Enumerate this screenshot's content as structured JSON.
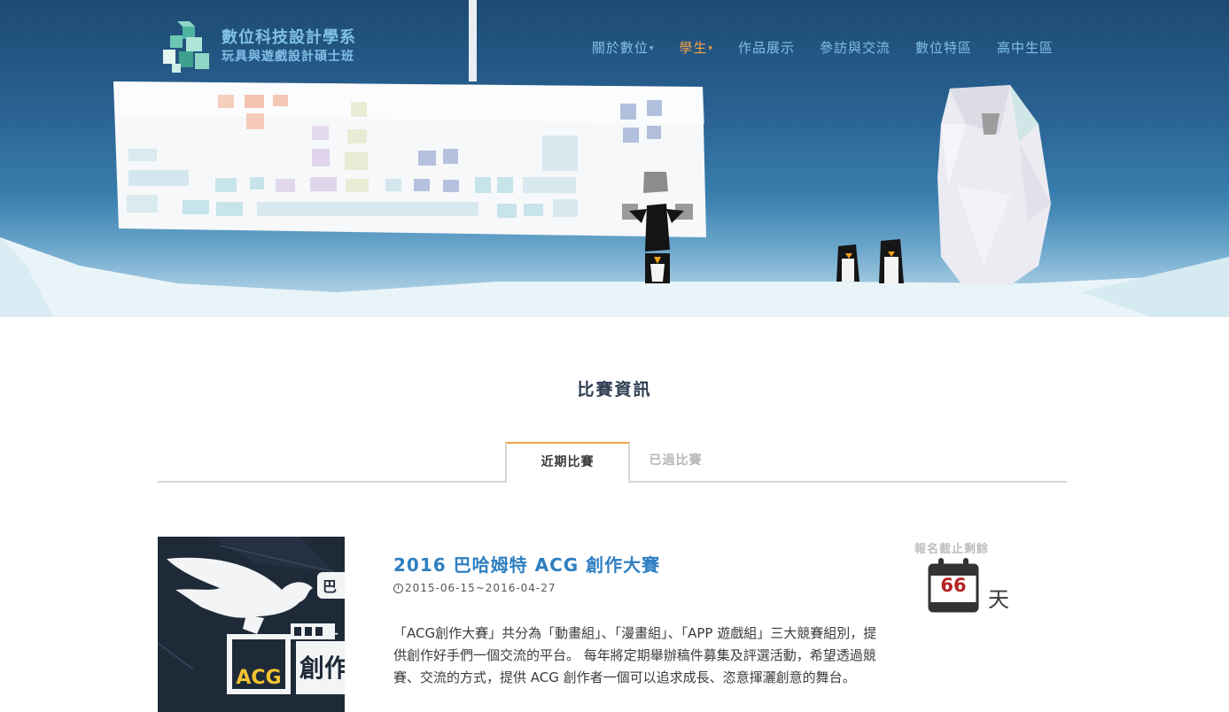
{
  "header": {
    "logo_line1": "數位科技設計學系",
    "logo_line2": "玩具與遊戲設計碩士班",
    "nav": [
      {
        "label": "關於數位",
        "dropdown": true,
        "active": false
      },
      {
        "label": "學生",
        "dropdown": true,
        "active": true
      },
      {
        "label": "作品展示",
        "dropdown": false,
        "active": false
      },
      {
        "label": "參訪與交流",
        "dropdown": false,
        "active": false
      },
      {
        "label": "數位特區",
        "dropdown": false,
        "active": false
      },
      {
        "label": "高中生區",
        "dropdown": false,
        "active": false
      }
    ],
    "caret": "▾"
  },
  "section": {
    "title": "比賽資訊",
    "tabs": [
      {
        "label": "近期比賽",
        "active": true
      },
      {
        "label": "已過比賽",
        "active": false
      }
    ]
  },
  "competition": {
    "title": "2016 巴哈姆特 ACG 創作大賽",
    "date": "2015-06-15~2016-04-27",
    "description": "「ACG創作大賽」共分為「動畫組」、「漫畫組」、「APP 遊戲組」三大競賽組別，提供創作好手們一個交流的平台。 每年將定期舉辦稿件募集及評選活動，希望透過競賽、交流的方式，提供 ACG 創作者一個可以追求成長、恣意揮灑創意的舞台。",
    "countdown_label": "報名截止剩餘",
    "days_remaining": "66",
    "days_unit": "天",
    "image_text": {
      "badge": "巴",
      "acg": "ACG",
      "chuang": "創作"
    }
  },
  "colors": {
    "accent": "#f4a24a",
    "link": "#2f7fc2",
    "nav": "#7fc0e6",
    "countdown": "#b42222"
  },
  "icons": [
    "logo-cube-icon",
    "clock-icon",
    "calendar-icon",
    "dragon-illustration"
  ]
}
